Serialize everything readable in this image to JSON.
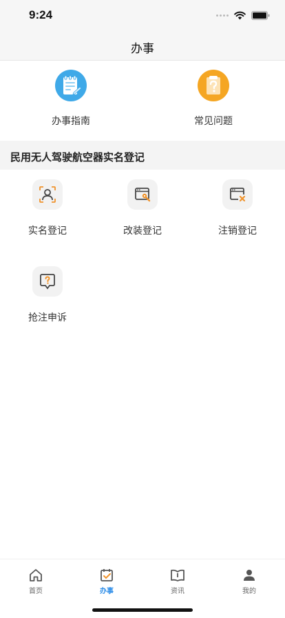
{
  "status_bar": {
    "time": "9:24"
  },
  "nav": {
    "title": "办事"
  },
  "quick_entries": [
    {
      "label": "办事指南",
      "icon": "guide-notebook-icon",
      "color": "#3fa9e8"
    },
    {
      "label": "常见问题",
      "icon": "faq-clipboard-icon",
      "color": "#f5a623"
    }
  ],
  "section": {
    "title": "民用无人驾驶航空器实名登记"
  },
  "services": [
    {
      "label": "实名登记",
      "icon": "person-scan-icon"
    },
    {
      "label": "改装登记",
      "icon": "window-wrench-icon"
    },
    {
      "label": "注销登记",
      "icon": "window-close-icon"
    },
    {
      "label": "抢注申诉",
      "icon": "message-question-icon"
    }
  ],
  "accent_color": "#f0932b",
  "tabs": [
    {
      "label": "首页",
      "icon": "home-icon",
      "active": false
    },
    {
      "label": "办事",
      "icon": "task-check-icon",
      "active": true
    },
    {
      "label": "资讯",
      "icon": "book-icon",
      "active": false
    },
    {
      "label": "我的",
      "icon": "user-icon",
      "active": false
    }
  ],
  "tab_active_color": "#2b8ce8"
}
